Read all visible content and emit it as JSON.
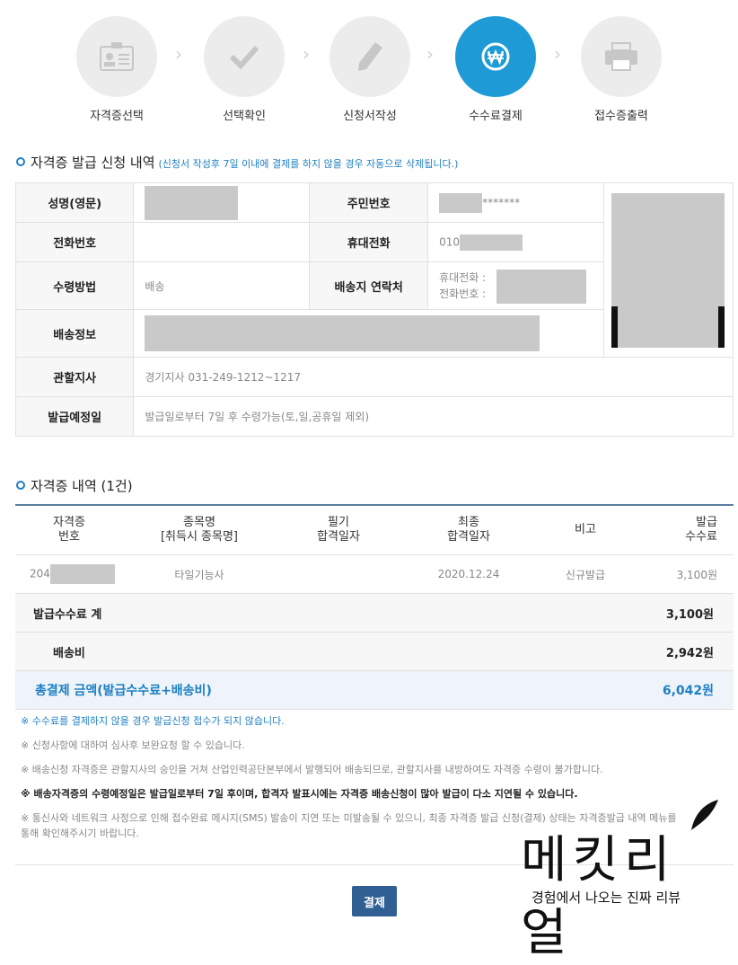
{
  "steps": [
    {
      "label": "자격증선택",
      "icon": "id-card-icon",
      "active": false
    },
    {
      "label": "선택확인",
      "icon": "check-icon",
      "active": false
    },
    {
      "label": "신청서작성",
      "icon": "pencil-icon",
      "active": false
    },
    {
      "label": "수수료결제",
      "icon": "won-icon",
      "active": true
    },
    {
      "label": "접수증출력",
      "icon": "printer-icon",
      "active": false
    }
  ],
  "application": {
    "title": "자격증 발급 신청 내역",
    "note": "(신청서 작성후 7일 이내에 결제를 하지 않을 경우 자동으로 삭제됩니다.)",
    "name_label": "성명(영문)",
    "rrn_label": "주민번호",
    "rrn_suffix": "*******",
    "phone_label": "전화번호",
    "mobile_label": "휴대전화",
    "mobile_prefix": "010",
    "receive_label": "수령방법",
    "receive_value": "배송",
    "contact_label": "배송지 연락처",
    "contact_mobile": "휴대전화 :",
    "contact_phone": "전화번호 :",
    "delivery_label": "배송정보",
    "branch_label": "관할지사",
    "branch_value": "경기지사 031-249-1212~1217",
    "issue_label": "발급예정일",
    "issue_value": "발급일로부터 7일 후 수령가능(토,일,공휴일 제외)"
  },
  "cert": {
    "title": "자격증 내역 (1건)",
    "headers": [
      "자격증\n번호",
      "종목명\n[취득시 종목명]",
      "필기\n합격일자",
      "최종\n합격일자",
      "비고",
      "발급\n수수료"
    ],
    "row": {
      "number_prefix": "204",
      "subject": "타일기능사",
      "written_date": "",
      "final_date": "2020.12.24",
      "remark": "신규발급",
      "fee": "3,100원"
    },
    "fee_total_label": "발급수수료 계",
    "fee_total_value": "3,100원",
    "shipping_label": "배송비",
    "shipping_value": "2,942원",
    "grand_label": "총결제 금액(발급수수료+배송비)",
    "grand_value": "6,042원"
  },
  "notices": [
    "※ 수수료를 결제하지 않을 경우 발급신청 접수가 되지 않습니다.",
    "※ 신청사항에 대하여 심사후 보완요청 할 수 있습니다.",
    "※ 배송신청 자격증은 관할지사의 승인을 거쳐 산업인력공단본부에서 발행되어 배송되므로, 관할지사를 내방하여도 자격증 수령이 불가합니다.",
    "※ 배송자격증의 수령예정일은 발급일로부터 7일 후이며, 합격자 발표시에는 자격증 배송신청이 많아 발급이 다소 지연될 수 있습니다.",
    "※ 통신사와 네트워크 사정으로 인해 접수완료 메시지(SMS) 발송이 지연 또는 미발송될 수 있으니, 최종 자격증 발급 신청(결제) 상태는 자격증발급 내역 메뉴를 통해 확인해주시기 바랍니다."
  ],
  "pay_button": "결제",
  "watermark": {
    "big": "메킷리얼",
    "small": "경험에서 나오는 진짜 리뷰"
  },
  "colors": {
    "accent": "#1e9bd7",
    "link_blue": "#1e7fc2",
    "button": "#2f5f93"
  }
}
